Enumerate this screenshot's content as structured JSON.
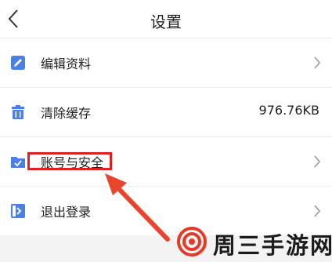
{
  "header": {
    "title": "设置"
  },
  "rows": [
    {
      "label": "编辑资料",
      "icon": "edit-profile-icon"
    },
    {
      "label": "清除缓存",
      "icon": "trash-icon",
      "value": "976.76KB"
    },
    {
      "label": "账号与安全",
      "icon": "folder-check-icon"
    },
    {
      "label": "退出登录",
      "icon": "logout-icon"
    }
  ],
  "watermark": {
    "text": "周三手游网"
  },
  "colors": {
    "icon_blue": "#4a7fe8",
    "highlight_red": "#e02020",
    "arrow_red": "#e8452c"
  }
}
